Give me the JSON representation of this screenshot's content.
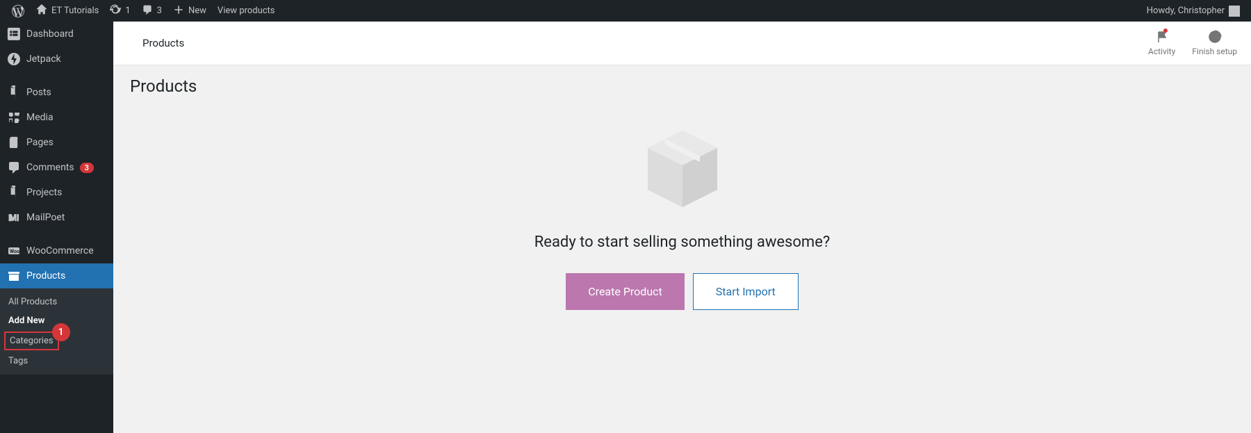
{
  "adminbar": {
    "site_name": "ET Tutorials",
    "updates_count": "1",
    "comments_count": "3",
    "new_label": "New",
    "view_products_label": "View products",
    "howdy": "Howdy, Christopher"
  },
  "sidebar": {
    "items": [
      {
        "label": "Dashboard"
      },
      {
        "label": "Jetpack"
      },
      {
        "label": "Posts"
      },
      {
        "label": "Media"
      },
      {
        "label": "Pages"
      },
      {
        "label": "Comments",
        "badge": "3"
      },
      {
        "label": "Projects"
      },
      {
        "label": "MailPoet"
      },
      {
        "label": "WooCommerce"
      },
      {
        "label": "Products"
      }
    ],
    "submenu": [
      {
        "label": "All Products"
      },
      {
        "label": "Add New"
      },
      {
        "label": "Categories",
        "annotation": "1"
      },
      {
        "label": "Tags"
      }
    ]
  },
  "header": {
    "title": "Products",
    "activity_label": "Activity",
    "finish_setup_label": "Finish setup"
  },
  "main": {
    "page_title": "Products",
    "empty_heading": "Ready to start selling something awesome?",
    "create_button": "Create Product",
    "import_button": "Start Import"
  }
}
